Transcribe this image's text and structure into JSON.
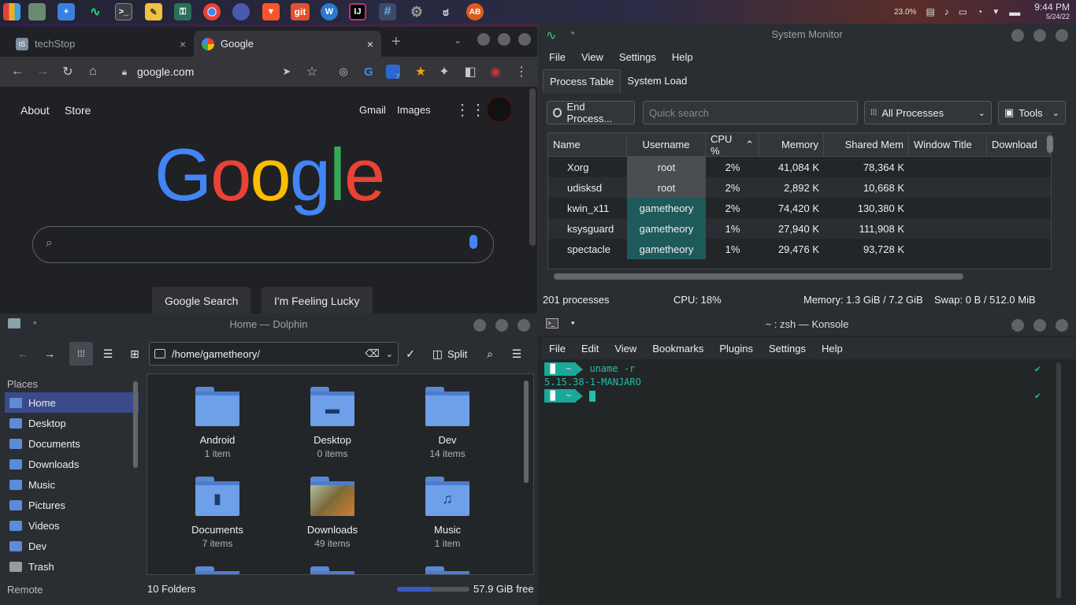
{
  "panel": {
    "battery_pct": "23.0%",
    "time": "9:44 PM",
    "date": "5/24/22",
    "git_label": "git"
  },
  "chrome": {
    "tabs": [
      {
        "label": "techStop",
        "favicon": "tS"
      },
      {
        "label": "Google"
      }
    ],
    "url": "google.com",
    "ext_badge": "7",
    "page": {
      "about": "About",
      "store": "Store",
      "gmail": "Gmail",
      "images": "Images",
      "logo": "Google",
      "search_btn": "Google Search",
      "lucky_btn": "I'm Feeling Lucky"
    }
  },
  "sysmon": {
    "title": "System Monitor",
    "menu": [
      "File",
      "View",
      "Settings",
      "Help"
    ],
    "tabs": [
      "Process Table",
      "System Load"
    ],
    "end_process": "End Process...",
    "search_placeholder": "Quick search",
    "filter": "All Processes",
    "tools": "Tools",
    "columns": [
      "Name",
      "Username",
      "CPU %",
      "Memory",
      "Shared Mem",
      "Window Title",
      "Download"
    ],
    "rows": [
      {
        "name": "Xorg",
        "user": "root",
        "cpu": "2%",
        "mem": "41,084 K",
        "shared": "78,364 K"
      },
      {
        "name": "udisksd",
        "user": "root",
        "cpu": "2%",
        "mem": "2,892 K",
        "shared": "10,668 K"
      },
      {
        "name": "kwin_x11",
        "user": "gametheory",
        "cpu": "2%",
        "mem": "74,420 K",
        "shared": "130,380 K"
      },
      {
        "name": "ksysguard",
        "user": "gametheory",
        "cpu": "1%",
        "mem": "27,940 K",
        "shared": "111,908 K"
      },
      {
        "name": "spectacle",
        "user": "gametheory",
        "cpu": "1%",
        "mem": "29,476 K",
        "shared": "93,728 K"
      }
    ],
    "status": {
      "processes": "201 processes",
      "cpu": "CPU: 18%",
      "memory": "Memory: 1.3 GiB / 7.2 GiB",
      "swap": "Swap: 0 B / 512.0 MiB"
    }
  },
  "dolphin": {
    "title": "Home — Dolphin",
    "path": "/home/gametheory/",
    "split": "Split",
    "places_header": "Places",
    "places": [
      "Home",
      "Desktop",
      "Documents",
      "Downloads",
      "Music",
      "Pictures",
      "Videos",
      "Dev",
      "Trash"
    ],
    "remote_header": "Remote",
    "files": [
      {
        "name": "Android",
        "sub": "1 item"
      },
      {
        "name": "Desktop",
        "sub": "0 items"
      },
      {
        "name": "Dev",
        "sub": "14 items"
      },
      {
        "name": "Documents",
        "sub": "7 items"
      },
      {
        "name": "Downloads",
        "sub": "49 items"
      },
      {
        "name": "Music",
        "sub": "1 item"
      }
    ],
    "folder_count": "10 Folders",
    "free_space": "57.9 GiB free",
    "disk_used_fraction": 0.47
  },
  "konsole": {
    "title": "~ : zsh — Konsole",
    "menu": [
      "File",
      "Edit",
      "View",
      "Bookmarks",
      "Plugins",
      "Settings",
      "Help"
    ],
    "prompt_dir": "~",
    "command": "uname -r",
    "output": "5.15.38-1-MANJARO",
    "check": "✔"
  }
}
